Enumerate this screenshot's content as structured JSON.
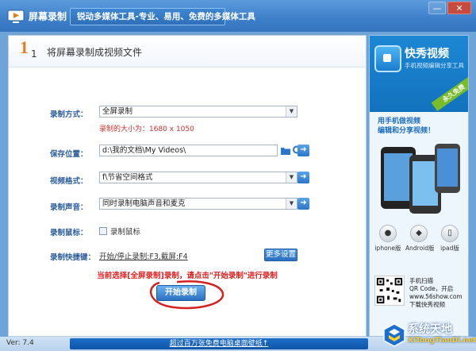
{
  "window": {
    "title": "屏幕录制",
    "slogan": "锐动多媒体工具-专业、易用、免费的多媒体工具",
    "buttons": {
      "minimize": "—",
      "close": "✕"
    }
  },
  "step": {
    "number": "1",
    "sub_number": "1",
    "title": "将屏幕录制成视频文件"
  },
  "form": {
    "record_mode": {
      "label": "录制方式：",
      "value": "全屏录制"
    },
    "record_size": "录制的大小为：1680 x 1050",
    "save_location": {
      "label": "保存位置：",
      "value": "d:\\我的文档\\My Videos\\"
    },
    "video_format": {
      "label": "视频格式：",
      "value": "f\\节省空间格式"
    },
    "record_audio": {
      "label": "录制声音：",
      "value": "同时录制电脑声音和麦克"
    },
    "record_mouse": {
      "label": "录制鼠标：",
      "checkbox_label": "录制鼠标",
      "checked": false
    },
    "hotkeys": {
      "label": "录制快捷键：",
      "value": "开始/停止录制:F3,截屏:F4"
    },
    "more_settings": "更多设置",
    "notice": "当前选择[全屏录制]录制，请点击\"开始录制\"进行录制",
    "start_button": "开始录制"
  },
  "ad": {
    "brand": "快秀视频",
    "brand_sub": "手机视频编辑分享工具",
    "ribbon": "永久免费",
    "slogan_line1": "用手机做视频",
    "slogan_line2": "编辑和分享视频！",
    "platforms": [
      {
        "icon": "apple-icon",
        "glyph": "",
        "name": "iphone版"
      },
      {
        "icon": "android-icon",
        "glyph": "◆",
        "name": "Android版"
      },
      {
        "icon": "ipad-icon",
        "glyph": "▯",
        "name": "ipad版"
      }
    ],
    "qr_lines": [
      "手机扫描",
      "QR Code，开启",
      "www.56show.com",
      "下载快秀视频"
    ]
  },
  "footer": {
    "version": "Ver: 7.4",
    "banner": "超过百万张免费电脑桌面壁纸↑"
  },
  "watermark": {
    "title": "系统天地",
    "url": "XiTongTianDi.net"
  },
  "colors": {
    "accent": "#2c76c8",
    "label": "#2a5c9c",
    "warning": "#e02020"
  }
}
